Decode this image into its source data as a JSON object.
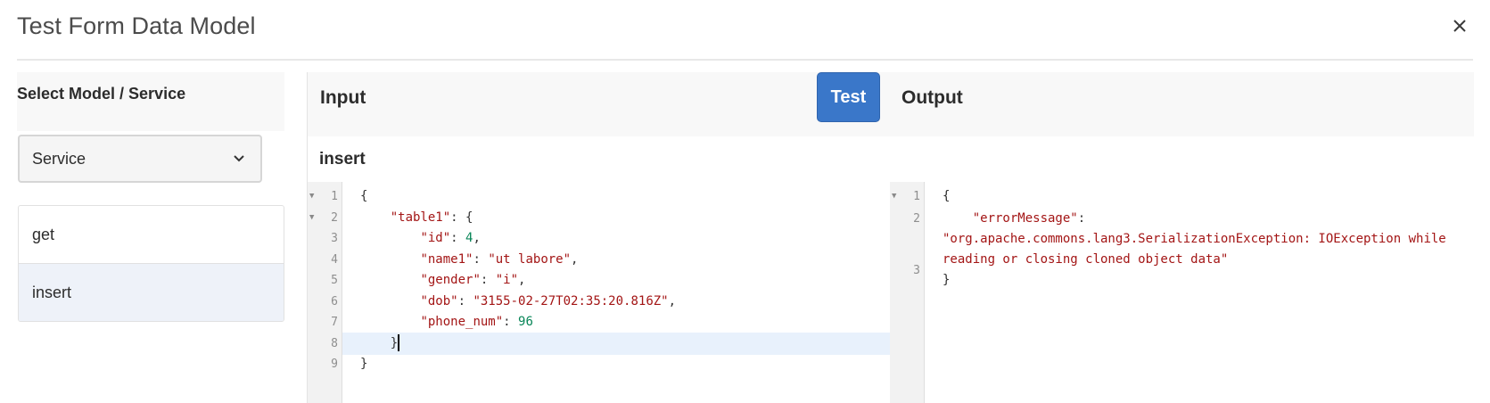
{
  "dialog": {
    "title": "Test Form Data Model",
    "close_icon": "close-icon"
  },
  "left_panel": {
    "heading": "Select Model / Service",
    "dropdown": {
      "value": "Service"
    },
    "services": [
      {
        "label": "get",
        "selected": false
      },
      {
        "label": "insert",
        "selected": true
      }
    ]
  },
  "right_panel": {
    "input_label": "Input",
    "test_button": "Test",
    "output_label": "Output",
    "operation": "insert"
  },
  "input_editor": {
    "lines": [
      {
        "n": "1",
        "fold": true,
        "parts": [
          [
            "p",
            "{"
          ]
        ]
      },
      {
        "n": "2",
        "fold": true,
        "parts": [
          [
            "p",
            "    "
          ],
          [
            "k",
            "\"table1\""
          ],
          [
            "p",
            ": {"
          ]
        ]
      },
      {
        "n": "3",
        "fold": false,
        "parts": [
          [
            "p",
            "        "
          ],
          [
            "k",
            "\"id\""
          ],
          [
            "p",
            ": "
          ],
          [
            "n",
            "4"
          ],
          [
            "p",
            ","
          ]
        ]
      },
      {
        "n": "4",
        "fold": false,
        "parts": [
          [
            "p",
            "        "
          ],
          [
            "k",
            "\"name1\""
          ],
          [
            "p",
            ": "
          ],
          [
            "s",
            "\"ut labore\""
          ],
          [
            "p",
            ","
          ]
        ]
      },
      {
        "n": "5",
        "fold": false,
        "parts": [
          [
            "p",
            "        "
          ],
          [
            "k",
            "\"gender\""
          ],
          [
            "p",
            ": "
          ],
          [
            "s",
            "\"i\""
          ],
          [
            "p",
            ","
          ]
        ]
      },
      {
        "n": "6",
        "fold": false,
        "parts": [
          [
            "p",
            "        "
          ],
          [
            "k",
            "\"dob\""
          ],
          [
            "p",
            ": "
          ],
          [
            "s",
            "\"3155-02-27T02:35:20.816Z\""
          ],
          [
            "p",
            ","
          ]
        ]
      },
      {
        "n": "7",
        "fold": false,
        "parts": [
          [
            "p",
            "        "
          ],
          [
            "k",
            "\"phone_num\""
          ],
          [
            "p",
            ": "
          ],
          [
            "n",
            "96"
          ]
        ]
      },
      {
        "n": "8",
        "fold": false,
        "parts": [
          [
            "p",
            "    }"
          ]
        ],
        "active": true
      },
      {
        "n": "9",
        "fold": false,
        "parts": [
          [
            "p",
            "}"
          ]
        ]
      }
    ]
  },
  "output_editor": {
    "line_numbers": [
      "1",
      "2",
      "3"
    ],
    "open_brace": "{",
    "key": "\"errorMessage\"",
    "colon": ":",
    "value_line1": "\"org.apache.commons.lang3.SerializationException: IOException while",
    "value_line2": "reading or closing cloned object data\"",
    "close_brace": "}"
  }
}
